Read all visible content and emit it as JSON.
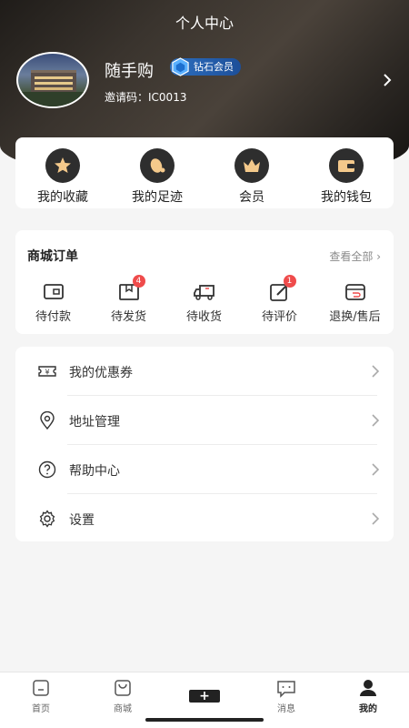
{
  "header": {
    "title": "个人中心",
    "username": "随手购",
    "vip_label": "钻石会员",
    "invite_code": "邀请码：IC0013"
  },
  "quick_actions": [
    {
      "label": "我的收藏",
      "icon": "star-icon"
    },
    {
      "label": "我的足迹",
      "icon": "footprint-icon"
    },
    {
      "label": "会员",
      "icon": "crown-icon"
    },
    {
      "label": "我的钱包",
      "icon": "wallet-icon"
    }
  ],
  "orders": {
    "title": "商城订单",
    "view_all": "查看全部",
    "items": [
      {
        "label": "待付款",
        "icon": "card-icon",
        "badge": ""
      },
      {
        "label": "待发货",
        "icon": "package-icon",
        "badge": "4"
      },
      {
        "label": "待收货",
        "icon": "truck-icon",
        "badge": ""
      },
      {
        "label": "待评价",
        "icon": "edit-icon",
        "badge": "1"
      },
      {
        "label": "退换/售后",
        "icon": "return-icon",
        "badge": ""
      }
    ]
  },
  "menu": [
    {
      "label": "我的优惠券",
      "icon": "coupon-icon"
    },
    {
      "label": "地址管理",
      "icon": "location-icon"
    },
    {
      "label": "帮助中心",
      "icon": "help-icon"
    },
    {
      "label": "设置",
      "icon": "gear-icon"
    }
  ],
  "tabbar": [
    {
      "label": "首页",
      "icon": "home-icon"
    },
    {
      "label": "商城",
      "icon": "shopping-bag-icon"
    },
    {
      "label": "",
      "icon": "plus-icon"
    },
    {
      "label": "消息",
      "icon": "message-icon"
    },
    {
      "label": "我的",
      "icon": "user-icon",
      "active": true
    }
  ],
  "colors": {
    "accent": "#222222",
    "badge": "#ef4b4b",
    "vip": "#2d6fbf"
  }
}
